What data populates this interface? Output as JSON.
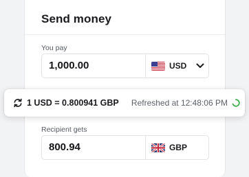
{
  "card": {
    "title": "Send money"
  },
  "you_pay": {
    "label": "You pay",
    "amount": "1,000.00",
    "currency_code": "USD",
    "flag_icon": "us-flag-icon",
    "dropdown_icon": "chevron-down-icon"
  },
  "rate_bar": {
    "refresh_icon": "refresh-icon",
    "rate": "1 USD = 0.800941 GBP",
    "refreshed": "Refreshed at 12:48:06 PM",
    "spinner_color": "#3dae49"
  },
  "recipient_gets": {
    "label": "Recipient gets",
    "amount": "800.94",
    "currency_code": "GBP",
    "flag_icon": "uk-flag-icon"
  }
}
